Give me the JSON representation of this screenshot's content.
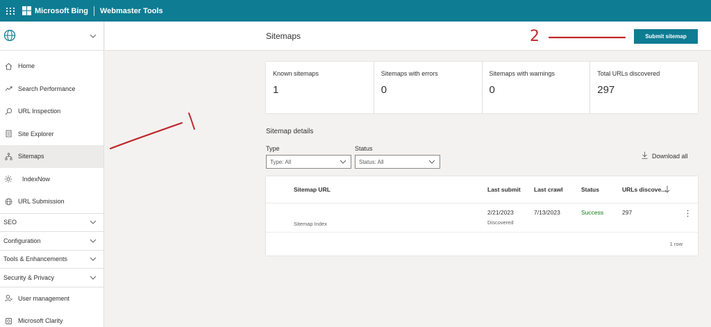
{
  "app": {
    "brand": "Microsoft Bing",
    "product": "Webmaster Tools",
    "accent_color": "#0e7c93"
  },
  "sidebar": {
    "site_icon": "globe-icon",
    "items": [
      {
        "label": "Home",
        "icon": "home-icon"
      },
      {
        "label": "Search Performance",
        "icon": "trend-icon"
      },
      {
        "label": "URL Inspection",
        "icon": "search-icon"
      },
      {
        "label": "Site Explorer",
        "icon": "document-icon"
      },
      {
        "label": "Sitemaps",
        "icon": "sitemap-icon",
        "active": true
      },
      {
        "label": "IndexNow",
        "icon": "gear-icon"
      },
      {
        "label": "URL Submission",
        "icon": "globe-icon"
      }
    ],
    "sections": [
      "SEO",
      "Configuration",
      "Tools & Enhancements",
      "Security & Privacy"
    ],
    "footer_items": [
      {
        "label": "User management",
        "icon": "user-icon"
      },
      {
        "label": "Microsoft Clarity",
        "icon": "clarity-icon"
      }
    ]
  },
  "header": {
    "title": "Sitemaps",
    "submit_label": "Submit sitemap"
  },
  "stats": [
    {
      "label": "Known sitemaps",
      "value": "1"
    },
    {
      "label": "Sitemaps with errors",
      "value": "0"
    },
    {
      "label": "Sitemaps with warnings",
      "value": "0"
    },
    {
      "label": "Total URLs discovered",
      "value": "297"
    }
  ],
  "details": {
    "title": "Sitemap details",
    "filters": [
      {
        "label": "Type",
        "value": "Type: All"
      },
      {
        "label": "Status",
        "value": "Status: All"
      }
    ],
    "download_label": "Download all",
    "columns": [
      "Sitemap URL",
      "Last submit",
      "Last crawl",
      "Status",
      "URLs discove..."
    ],
    "rows": [
      {
        "type": "Sitemap Index",
        "last_submit": "2/21/2023",
        "submit_status": "Discovered",
        "last_crawl": "7/13/2023",
        "status": "Success",
        "urls": "297"
      }
    ],
    "row_count": "1 row",
    "status_success_color": "#107c10"
  },
  "annotations": {
    "marker_1": "1",
    "marker_2": "2",
    "marker_color": "#c0282b"
  }
}
